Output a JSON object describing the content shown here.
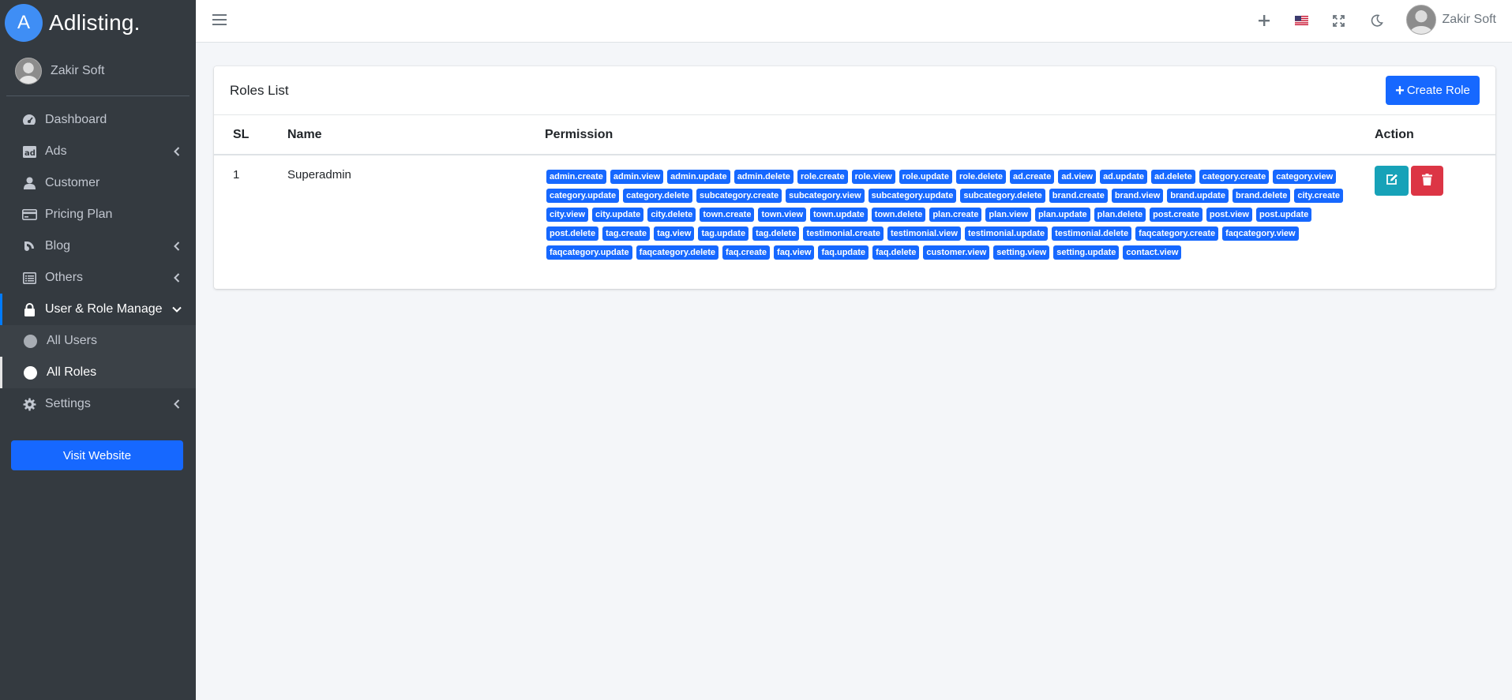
{
  "brand": {
    "logo_letter": "A",
    "name": "Adlisting."
  },
  "sidebar": {
    "user_name": "Zakir Soft",
    "items": [
      {
        "label": "Dashboard",
        "icon": "dashboard-icon",
        "chevron": false
      },
      {
        "label": "Ads",
        "icon": "ad-icon",
        "chevron": true
      },
      {
        "label": "Customer",
        "icon": "user-icon",
        "chevron": false
      },
      {
        "label": "Pricing Plan",
        "icon": "credit-card-icon",
        "chevron": false
      },
      {
        "label": "Blog",
        "icon": "blog-icon",
        "chevron": true
      },
      {
        "label": "Others",
        "icon": "list-icon",
        "chevron": true
      },
      {
        "label": "User & Role Manage",
        "icon": "lock-icon",
        "chevron": true,
        "open": true
      },
      {
        "label": "Settings",
        "icon": "gear-icon",
        "chevron": true
      }
    ],
    "sub_items": [
      {
        "label": "All Users",
        "active": false
      },
      {
        "label": "All Roles",
        "active": true
      }
    ],
    "visit_button": "Visit Website"
  },
  "topbar": {
    "user_name": "Zakir Soft",
    "icons": [
      "menu-icon",
      "plus-icon",
      "us-flag-icon",
      "fullscreen-icon",
      "moon-icon"
    ]
  },
  "card": {
    "title": "Roles List",
    "create_button": "Create Role",
    "columns": {
      "sl": "SL",
      "name": "Name",
      "permission": "Permission",
      "action": "Action"
    },
    "rows": [
      {
        "sl": "1",
        "name": "Superadmin",
        "permissions": [
          "admin.create",
          "admin.view",
          "admin.update",
          "admin.delete",
          "role.create",
          "role.view",
          "role.update",
          "role.delete",
          "ad.create",
          "ad.view",
          "ad.update",
          "ad.delete",
          "category.create",
          "category.view",
          "category.update",
          "category.delete",
          "subcategory.create",
          "subcategory.view",
          "subcategory.update",
          "subcategory.delete",
          "brand.create",
          "brand.view",
          "brand.update",
          "brand.delete",
          "city.create",
          "city.view",
          "city.update",
          "city.delete",
          "town.create",
          "town.view",
          "town.update",
          "town.delete",
          "plan.create",
          "plan.view",
          "plan.update",
          "plan.delete",
          "post.create",
          "post.view",
          "post.update",
          "post.delete",
          "tag.create",
          "tag.view",
          "tag.update",
          "tag.delete",
          "testimonial.create",
          "testimonial.view",
          "testimonial.update",
          "testimonial.delete",
          "faqcategory.create",
          "faqcategory.view",
          "faqcategory.update",
          "faqcategory.delete",
          "faq.create",
          "faq.view",
          "faq.update",
          "faq.delete",
          "customer.view",
          "setting.view",
          "setting.update",
          "contact.view"
        ]
      }
    ]
  },
  "colors": {
    "primary": "#1668ff",
    "sidebar_bg": "#343a40",
    "edit": "#17a2b8",
    "delete": "#dc3545"
  }
}
